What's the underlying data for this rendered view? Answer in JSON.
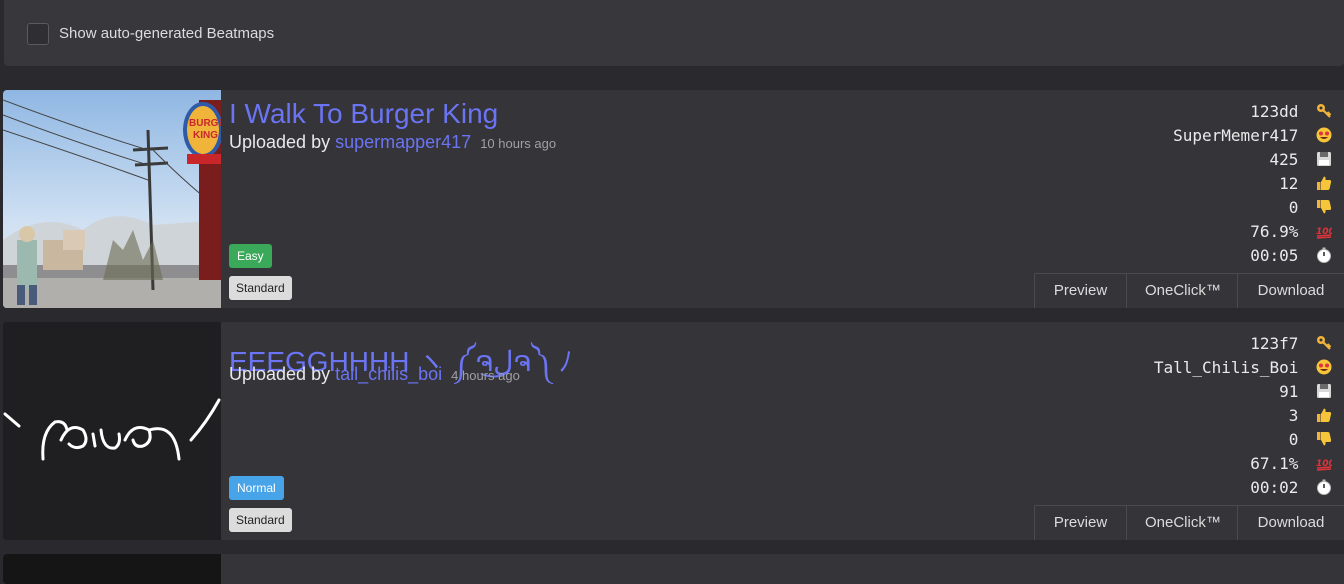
{
  "filter": {
    "auto_generated_label": "Show auto-generated Beatmaps",
    "auto_generated_checked": false
  },
  "cards": [
    {
      "title": "I Walk To Burger King",
      "uploaded_by_label": "Uploaded by",
      "uploader": "supermapper417",
      "time_ago": "10 hours ago",
      "difficulty": "Easy",
      "characteristic": "Standard",
      "stats": {
        "key": "123dd",
        "mapper": "SuperMemer417",
        "downloads": "425",
        "upvotes": "12",
        "downvotes": "0",
        "rating": "76.9%",
        "duration": "00:05"
      },
      "actions": {
        "preview": "Preview",
        "oneclick": "OneClick™",
        "download": "Download"
      }
    },
    {
      "title": "EEEGGHHHH ヽ ༼ຈل͜ຈ༽ ﾉ",
      "uploaded_by_label": "Uploaded by",
      "uploader": "tall_chilis_boi",
      "time_ago": "4 hours ago",
      "difficulty": "Normal",
      "characteristic": "Standard",
      "stats": {
        "key": "123f7",
        "mapper": "Tall_Chilis_Boi",
        "downloads": "91",
        "upvotes": "3",
        "downvotes": "0",
        "rating": "67.1%",
        "duration": "00:02"
      },
      "actions": {
        "preview": "Preview",
        "oneclick": "OneClick™",
        "download": "Download"
      }
    }
  ],
  "cover2_text": "ヽ ༼ຈل͜ຈ༽ ﾉ",
  "colors": {
    "link": "#6b74f2",
    "easy": "#3aa95a",
    "normal": "#48a4e8",
    "card_bg": "#343439",
    "page_bg": "#2a2a2e"
  },
  "icons": [
    "key-icon",
    "star-struck-face-icon",
    "floppy-disk-icon",
    "thumbs-up-icon",
    "thumbs-down-icon",
    "hundred-points-icon",
    "stopwatch-icon"
  ]
}
